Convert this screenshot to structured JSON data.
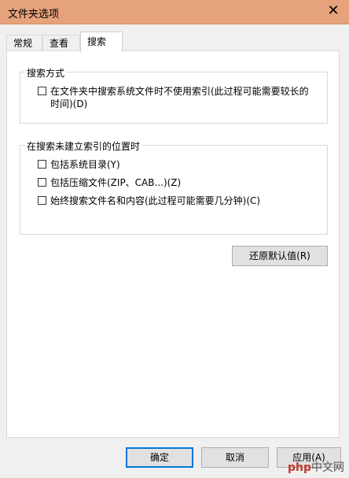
{
  "window": {
    "title": "文件夹选项",
    "close_glyph": "✕"
  },
  "tabs": [
    {
      "label": "常规",
      "active": false
    },
    {
      "label": "查看",
      "active": false
    },
    {
      "label": "搜索",
      "active": true
    }
  ],
  "search_method": {
    "legend": "搜索方式",
    "options": [
      {
        "label": "在文件夹中搜索系统文件时不使用索引(此过程可能需要较长的时间)(D)",
        "checked": false
      }
    ]
  },
  "non_indexed": {
    "legend": "在搜索未建立索引的位置时",
    "options": [
      {
        "label": "包括系统目录(Y)",
        "checked": false
      },
      {
        "label": "包括压缩文件(ZIP、CAB...)(Z)",
        "checked": false
      },
      {
        "label": "始终搜索文件名和内容(此过程可能需要几分钟)(C)",
        "checked": false
      }
    ]
  },
  "buttons": {
    "restore": "还原默认值(R)",
    "ok": "确定",
    "cancel": "取消",
    "apply": "应用(A)"
  },
  "watermark": {
    "brand": "php",
    "site": "中文网"
  }
}
